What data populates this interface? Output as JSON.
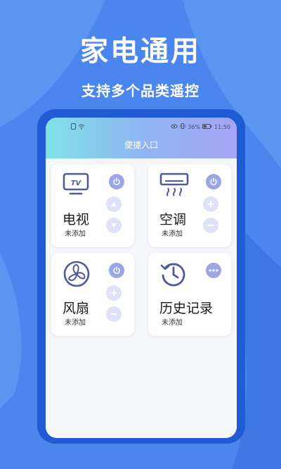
{
  "promo": {
    "headline": "家电通用",
    "subline": "支持多个品类遥控"
  },
  "status_bar": {
    "battery": "36%",
    "time": "11:50"
  },
  "screen": {
    "title": "便捷入口"
  },
  "cards": [
    {
      "name": "电视",
      "status": "未添加",
      "icon": "tv-icon"
    },
    {
      "name": "空调",
      "status": "未添加",
      "icon": "air-conditioner-icon"
    },
    {
      "name": "风扇",
      "status": "未添加",
      "icon": "fan-icon"
    },
    {
      "name": "历史记录",
      "status": "未添加",
      "icon": "history-icon"
    }
  ],
  "tv_icon_text": "TV",
  "colors": {
    "background": "#4a86ee",
    "phone_frame": "#1f5bd3",
    "accent": "#5a6fd6",
    "button_light": "#dfe2f6",
    "button_solid": "#9aa6e6"
  }
}
